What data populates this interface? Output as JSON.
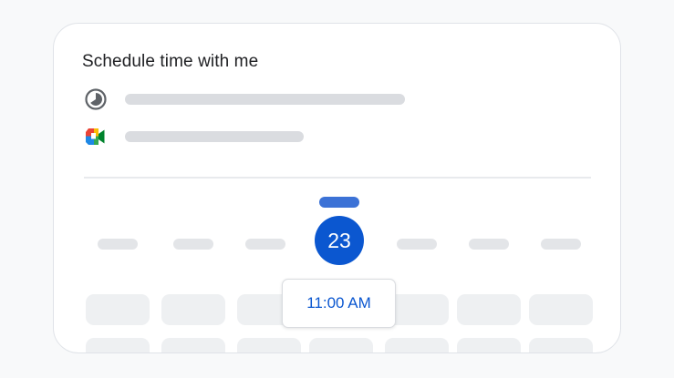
{
  "card": {
    "title": "Schedule time with me",
    "rows": [
      {
        "icon": "clock-icon"
      },
      {
        "icon": "google-meet-icon"
      }
    ]
  },
  "calendar": {
    "selected_date": "23",
    "selected_time": "11:00 AM"
  },
  "colors": {
    "accent": "#0b57d0",
    "placeholder": "#dadce0",
    "background": "#f8f9fa"
  }
}
